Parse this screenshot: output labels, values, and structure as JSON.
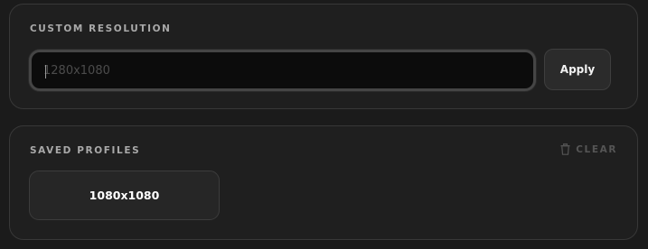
{
  "custom_resolution": {
    "section_title": "CUSTOM RESOLUTION",
    "input_value": "",
    "input_placeholder": "1280x1080",
    "apply_label": "Apply"
  },
  "saved_profiles": {
    "section_title": "SAVED PROFILES",
    "clear_label": "CLEAR",
    "clear_icon": "trash-icon",
    "items": [
      {
        "label": "1080x1080"
      }
    ]
  }
}
